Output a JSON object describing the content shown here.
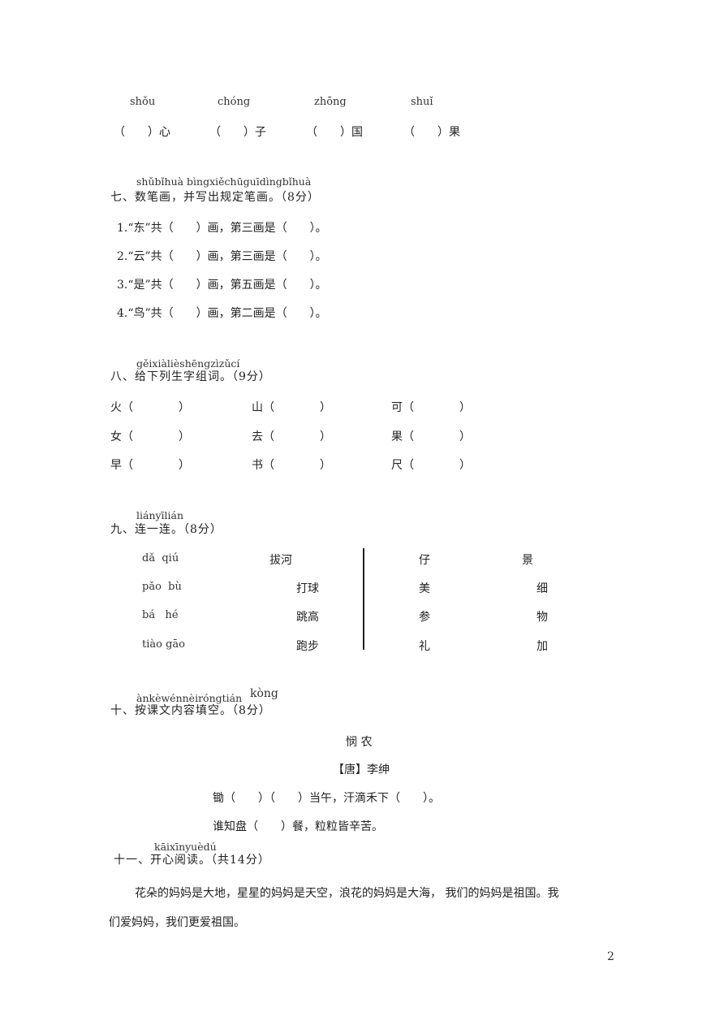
{
  "section6_tail": {
    "items": [
      {
        "pinyin": "shǒu",
        "blank": "（　　）",
        "suffix": "心"
      },
      {
        "pinyin": "chóng",
        "blank": "（　　）",
        "suffix": "子"
      },
      {
        "pinyin": "zhōng",
        "blank": "（　　）",
        "suffix": "国"
      },
      {
        "pinyin": "shuǐ",
        "blank": "（　　）",
        "suffix": "果"
      }
    ]
  },
  "section7": {
    "pinyin": "shǔbǐhuà  bìngxiěchūguīdìngbǐhuà",
    "title": "七、数笔画，并写出规定笔画。（8分）",
    "items": [
      "1.“东”共（　　）画，第三画是（　　）。",
      "2.“云”共（　　）画，第三画是（　　）。",
      "3.“是”共（　　）画，第五画是（　　）。",
      "4.“鸟”共（　　）画，第二画是（　　）。"
    ]
  },
  "section8": {
    "pinyin": "gěixiàlièshēngzìzǔcí",
    "title": "八、给下列生字组词。（9分）",
    "rows": [
      [
        "火（　　　　）",
        "山（　　　　）",
        "可（　　　　）"
      ],
      [
        "女（　　　　）",
        "去（　　　　）",
        "果（　　　　）"
      ],
      [
        "早（　　　　）",
        "书（　　　　）",
        "尺（　　　　）"
      ]
    ]
  },
  "section9": {
    "pinyin": "liányīlián",
    "title": "九、连一连。（8分）",
    "left_pinyin": [
      "dǎ  qiú",
      "pǎo  bù",
      "bá   hé",
      "tiào gāo"
    ],
    "left_words": [
      "拔河",
      "打球",
      "跳高",
      "跑步"
    ],
    "right_col1": [
      "仔",
      "美",
      "参",
      "礼"
    ],
    "right_col2": [
      "景",
      "细",
      "物",
      "加"
    ]
  },
  "section10": {
    "pinyin": "ànkèwénnèiróngtián",
    "pinyin_extra": "kòng",
    "title": "十、按课文内容填空。（8分）",
    "poem_title": "悯 农",
    "poem_author": "【唐】李绅",
    "poem_lines": [
      "锄（　　）（　　）当午，汗滴禾下（　　）。",
      "谁知盘（　　）餐，粒粒皆辛苦。"
    ]
  },
  "section11": {
    "pinyin": "kāixīnyuèdú",
    "title": "十一、开心阅读。（共14分）",
    "paragraph_line1": "花朵的妈妈是大地，星星的妈妈是天空，浪花的妈妈是大海， 我们的妈妈是祖国。我",
    "paragraph_line2": "们爱妈妈，我们更爱祖国。"
  },
  "page_number": "2"
}
